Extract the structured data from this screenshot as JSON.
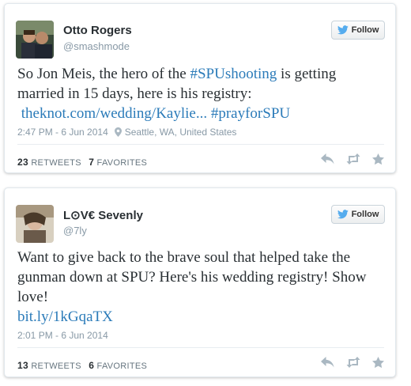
{
  "colors": {
    "link": "#2b7bb9",
    "text": "#292f33",
    "muted": "#8899a6",
    "twitter_blue": "#55acee"
  },
  "tweets": [
    {
      "author_name": "Otto Rogers",
      "handle": "@smashmode",
      "follow_label": "Follow",
      "text_line1_pre": "So Jon Meis, the hero of the ",
      "text_line1_hashtag": "#SPUshooting",
      "text_line1_post": " is getting",
      "text_line2": "married in 15 days, here is his registry:",
      "link_text": "theknot.com/wedding/Kaylie...",
      "hashtag2": "#prayforSPU",
      "timestamp": "2:47 PM - 6 Jun 2014",
      "location": "Seattle, WA, United States",
      "retweets_count": "23",
      "retweets_label": "RETWEETS",
      "favorites_count": "7",
      "favorites_label": "FAVORITES",
      "icons": [
        "reply-icon",
        "retweet-icon",
        "favorite-icon"
      ]
    },
    {
      "author_name": "L⊙V€ Sevenly",
      "handle": "@7ly",
      "follow_label": "Follow",
      "text_line1": "Want to give back to the brave soul that helped take the",
      "text_line2": "gunman down at SPU? Here's his wedding registry! Show",
      "text_line3": "love!",
      "link_text": "bit.ly/1kGqaTX",
      "timestamp": "2:01 PM - 6 Jun 2014",
      "retweets_count": "13",
      "retweets_label": "RETWEETS",
      "favorites_count": "6",
      "favorites_label": "FAVORITES",
      "icons": [
        "reply-icon",
        "retweet-icon",
        "favorite-icon"
      ]
    }
  ]
}
